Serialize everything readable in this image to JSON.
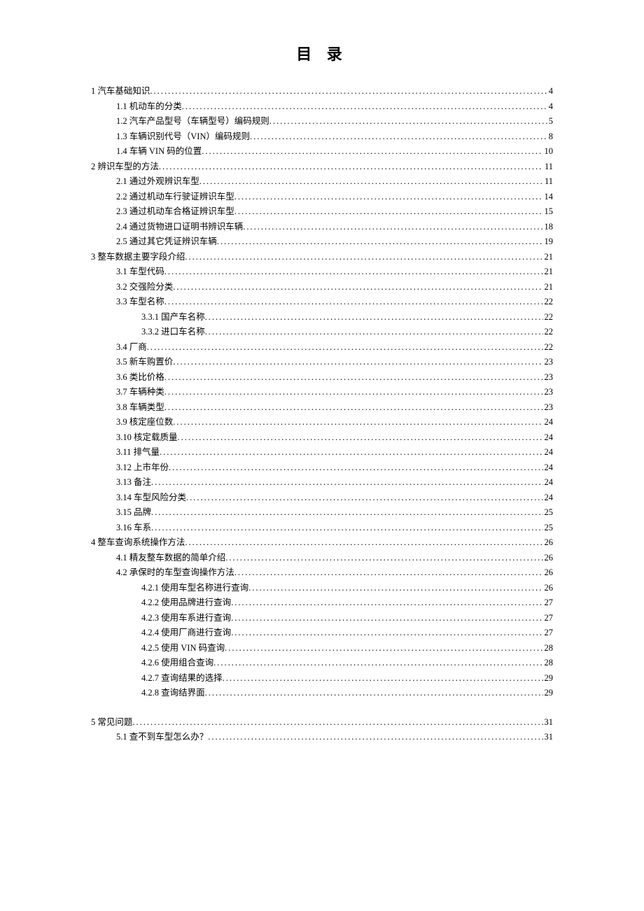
{
  "title": "目 录",
  "toc": [
    {
      "level": 1,
      "label": "1 汽车基础知识",
      "page": "4"
    },
    {
      "level": 2,
      "label": "1.1 机动车的分类",
      "page": "4"
    },
    {
      "level": 2,
      "label": "1.2 汽车产品型号（车辆型号）编码规则",
      "page": "5"
    },
    {
      "level": 2,
      "label": "1.3 车辆识别代号（VIN）编码规则",
      "page": "8"
    },
    {
      "level": 2,
      "label": "1.4 车辆 VIN 码的位置",
      "page": "10"
    },
    {
      "level": 1,
      "label": "2 辨识车型的方法",
      "page": "11"
    },
    {
      "level": 2,
      "label": "2.1 通过外观辨识车型",
      "page": "11"
    },
    {
      "level": 2,
      "label": "2.2 通过机动车行驶证辨识车型",
      "page": "14"
    },
    {
      "level": 2,
      "label": "2.3 通过机动车合格证辨识车型",
      "page": "15"
    },
    {
      "level": 2,
      "label": "2.4 通过货物进口证明书辨识车辆",
      "page": "18"
    },
    {
      "level": 2,
      "label": "2.5 通过其它凭证辨识车辆",
      "page": "19"
    },
    {
      "level": 1,
      "label": "3 整车数据主要字段介绍",
      "page": "21"
    },
    {
      "level": 2,
      "label": "3.1  车型代码",
      "page": "21"
    },
    {
      "level": 2,
      "label": "3.2 交强险分类",
      "page": "21"
    },
    {
      "level": 2,
      "label": "3.3 车型名称",
      "page": "22"
    },
    {
      "level": 3,
      "label": "3.3.1 国产车名称",
      "page": "22"
    },
    {
      "level": 3,
      "label": "3.3.2 进口车名称",
      "page": "22"
    },
    {
      "level": 2,
      "label": "3.4 厂商",
      "page": "22"
    },
    {
      "level": 2,
      "label": "3.5 新车购置价",
      "page": "23"
    },
    {
      "level": 2,
      "label": "3.6 类比价格",
      "page": "23"
    },
    {
      "level": 2,
      "label": "3.7 车辆种类",
      "page": "23"
    },
    {
      "level": 2,
      "label": "3.8 车辆类型",
      "page": "23"
    },
    {
      "level": 2,
      "label": "3.9 核定座位数",
      "page": "24"
    },
    {
      "level": 2,
      "label": "3.10 核定载质量",
      "page": "24"
    },
    {
      "level": 2,
      "label": "3.11 排气量",
      "page": "24"
    },
    {
      "level": 2,
      "label": "3.12 上市年份",
      "page": "24"
    },
    {
      "level": 2,
      "label": "3.13 备注",
      "page": "24"
    },
    {
      "level": 2,
      "label": "3.14 车型风险分类",
      "page": "24"
    },
    {
      "level": 2,
      "label": "3.15 品牌",
      "page": "25"
    },
    {
      "level": 2,
      "label": "3.16 车系",
      "page": "25"
    },
    {
      "level": 1,
      "label": "4 整车查询系统操作方法",
      "page": "26"
    },
    {
      "level": 2,
      "label": "4.1 精友整车数据的简单介绍",
      "page": "26"
    },
    {
      "level": 2,
      "label": "4.2 承保时的车型查询操作方法",
      "page": "26"
    },
    {
      "level": 3,
      "label": "4.2.1 使用车型名称进行查询",
      "page": "26"
    },
    {
      "level": 3,
      "label": "4.2.2 使用品牌进行查询",
      "page": "27"
    },
    {
      "level": 3,
      "label": "4.2.3 使用车系进行查询",
      "page": "27"
    },
    {
      "level": 3,
      "label": "4.2.4 使用厂商进行查询",
      "page": "27"
    },
    {
      "level": 3,
      "label": "4.2.5 使用 VIN 码查询",
      "page": "28"
    },
    {
      "level": 3,
      "label": "4.2.6 使用组合查询",
      "page": "28"
    },
    {
      "level": 3,
      "label": "4.2.7 查询结果的选择",
      "page": "29"
    },
    {
      "level": 3,
      "label": "4.2.8 查询结界面",
      "page": "29"
    },
    {
      "level": 0,
      "label": "__spacer__",
      "page": ""
    },
    {
      "level": 1,
      "label": "5 常见问题",
      "page": "31"
    },
    {
      "level": 2,
      "label": "5.1 查不到车型怎么办？",
      "page": "31"
    }
  ]
}
